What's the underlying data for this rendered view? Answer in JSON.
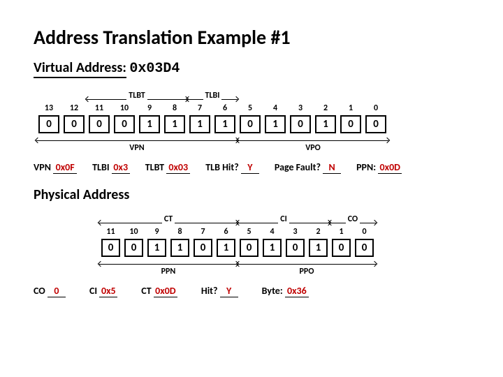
{
  "title": "Address Translation Example #1",
  "va_label": "Virtual Address:",
  "va_value": "0x03D4",
  "vbits": {
    "group_a": "TLBT",
    "group_b": "TLBI",
    "below_a": "VPN",
    "below_b": "VPO",
    "indices": [
      "13",
      "12",
      "11",
      "10",
      "9",
      "8",
      "7",
      "6",
      "5",
      "4",
      "3",
      "2",
      "1",
      "0"
    ],
    "values": [
      "0",
      "0",
      "0",
      "0",
      "1",
      "1",
      "1",
      "1",
      "0",
      "1",
      "0",
      "1",
      "0",
      "0"
    ]
  },
  "va_answers": {
    "vpn_lbl": "VPN",
    "vpn": "0x0F",
    "tlbi_lbl": "TLBI",
    "tlbi": "0x3",
    "tlbt_lbl": "TLBT",
    "tlbt": "0x03",
    "hit_lbl": "TLB Hit?",
    "hit": "Y",
    "pf_lbl": "Page Fault?",
    "pf": "N",
    "ppn_lbl": "PPN:",
    "ppn": "0x0D"
  },
  "pa_header": "Physical Address",
  "pbits": {
    "group_a": "CT",
    "group_b": "CI",
    "group_c": "CO",
    "below_a": "PPN",
    "below_b": "PPO",
    "indices": [
      "11",
      "10",
      "9",
      "8",
      "7",
      "6",
      "5",
      "4",
      "3",
      "2",
      "1",
      "0"
    ],
    "values": [
      "0",
      "0",
      "1",
      "1",
      "0",
      "1",
      "0",
      "1",
      "0",
      "1",
      "0",
      "0"
    ]
  },
  "pa_answers": {
    "co_lbl": "CO",
    "co": "0",
    "ci_lbl": "CI",
    "ci": "0x5",
    "ct_lbl": "CT",
    "ct": "0x0D",
    "hit_lbl": "Hit?",
    "hit": "Y",
    "byte_lbl": "Byte:",
    "byte": "0x36"
  }
}
